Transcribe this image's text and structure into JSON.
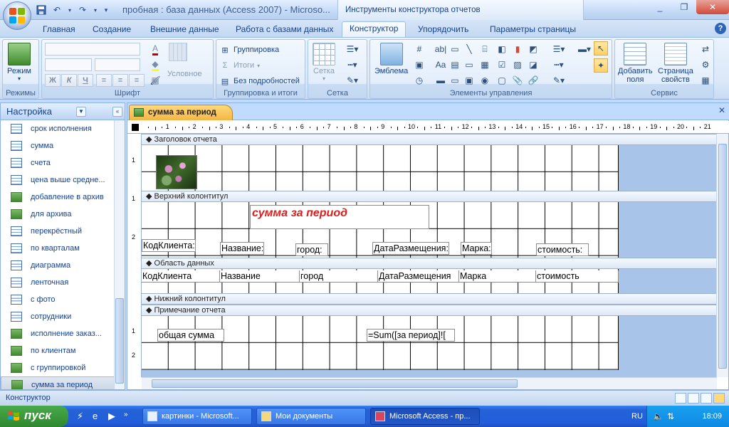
{
  "window": {
    "title": "пробная : база данных (Access 2007) - Microso...",
    "context_title": "Инструменты конструктора отчетов",
    "accent": "#15428b"
  },
  "tabs": [
    {
      "label": "Главная"
    },
    {
      "label": "Создание"
    },
    {
      "label": "Внешние данные"
    },
    {
      "label": "Работа с базами данных"
    },
    {
      "label": "Конструктор"
    },
    {
      "label": "Упорядочить"
    },
    {
      "label": "Параметры страницы"
    }
  ],
  "ribbon": {
    "groups": {
      "modes": "Режимы",
      "font": "Шрифт",
      "grouping": "Группировка и итоги",
      "grid": "Сетка",
      "controls": "Элементы управления",
      "service": "Сервис"
    },
    "mode_button": "Режим",
    "conditional_label": "Условное",
    "grouping_items": [
      "Группировка",
      "Итоги",
      "Без подробностей"
    ],
    "grid_button": "Сетка",
    "emblem_button": "Эмблема",
    "add_fields_label": "Добавить\nполя",
    "property_sheet_label": "Страница\nсвойств"
  },
  "nav": {
    "header": "Настройка",
    "items": [
      {
        "label": "срок исполнения",
        "kind": "table"
      },
      {
        "label": "сумма",
        "kind": "table"
      },
      {
        "label": "счета",
        "kind": "table"
      },
      {
        "label": "цена выше средне...",
        "kind": "table"
      },
      {
        "label": "добавление в архив",
        "kind": "append"
      },
      {
        "label": "для архива",
        "kind": "maketable"
      },
      {
        "label": "перекрёстный",
        "kind": "table"
      },
      {
        "label": "по кварталам",
        "kind": "table"
      },
      {
        "label": "диаграмма",
        "kind": "report"
      },
      {
        "label": "ленточная",
        "kind": "report"
      },
      {
        "label": "с фото",
        "kind": "report"
      },
      {
        "label": "сотрудники",
        "kind": "report"
      },
      {
        "label": "исполнение заказ...",
        "kind": "green"
      },
      {
        "label": "по клиентам",
        "kind": "green"
      },
      {
        "label": "с группировкой",
        "kind": "green"
      },
      {
        "label": "сумма за период",
        "kind": "green",
        "selected": true
      }
    ]
  },
  "document": {
    "tab_label": "сумма за период",
    "ruler_numbers": [
      "1",
      "2",
      "3",
      "4",
      "5",
      "6",
      "7",
      "8",
      "9",
      "10",
      "11",
      "12",
      "13",
      "14",
      "15",
      "16",
      "17",
      "18",
      "19",
      "20",
      "21"
    ],
    "sections": {
      "report_header": "Заголовок отчета",
      "page_header": "Верхний колонтитул",
      "detail": "Область данных",
      "page_footer": "Нижний колонтитул",
      "report_footer": "Примечание отчета"
    },
    "report_title": "сумма за период",
    "header_labels": [
      "КодКлиента:",
      "Название:",
      "город:",
      "ДатаРазмещения:",
      "Марка:",
      "стоимость:"
    ],
    "detail_fields": [
      "КодКлиента",
      "Название",
      "город",
      "ДатаРазмещения",
      "Марка",
      "стоимость"
    ],
    "footer_label": "общая сумма",
    "footer_expression": "=Sum([за период]![",
    "vruler_marks": [
      "1",
      "1",
      "2",
      "1",
      "2"
    ]
  },
  "status": {
    "text": "Конструктор"
  },
  "taskbar": {
    "start": "пуск",
    "tasks": [
      {
        "label": "картинки - Microsoft..."
      },
      {
        "label": "Мои документы"
      },
      {
        "label": "Microsoft Access - пр..."
      }
    ],
    "lang": "RU",
    "clock": "18:09"
  }
}
